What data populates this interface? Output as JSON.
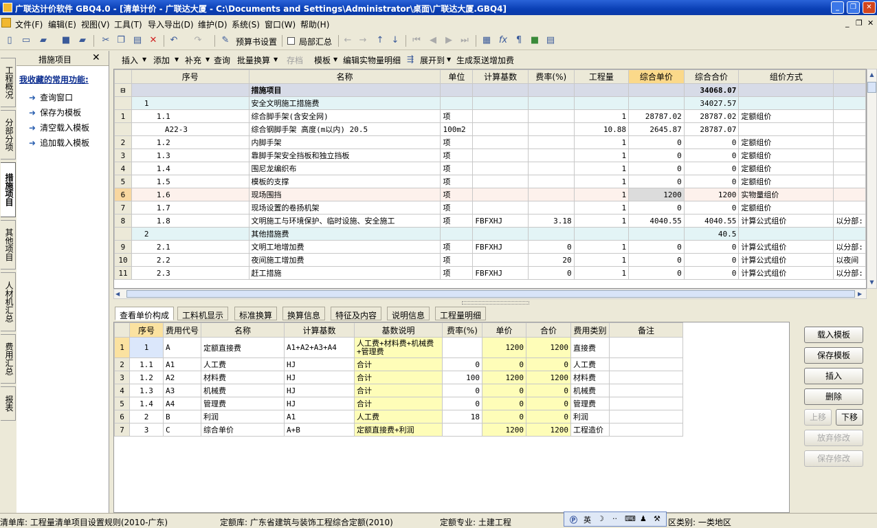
{
  "title": "广联达计价软件 GBQ4.0 - [清单计价 - 广联达大厦 - C:\\Documents and Settings\\Administrator\\桌面\\广联达大厦.GBQ4]",
  "menu": [
    "文件(F)",
    "编辑(E)",
    "视图(V)",
    "工具(T)",
    "导入导出(D)",
    "维护(D)",
    "系统(S)",
    "窗口(W)",
    "帮助(H)"
  ],
  "toolbar": {
    "budget_settings": "预算书设置",
    "partial_summary": "局部汇总"
  },
  "left_tabs": [
    "工程概况",
    "分部分项",
    "措施项目",
    "其他项目",
    "人材机汇总",
    "费用汇总",
    "报表"
  ],
  "fav_panel": {
    "header": "措施项目",
    "title": "我收藏的常用功能:",
    "items": [
      "查询窗口",
      "保存为模板",
      "清空载入模板",
      "追加载入模板"
    ]
  },
  "subtoolbar": [
    "插入",
    "添加",
    "补充",
    "查询",
    "批量换算",
    "存档",
    "模板",
    "编辑实物量明细",
    "展开到",
    "生成泵送增加费"
  ],
  "grid": {
    "headers": [
      "序号",
      "名称",
      "单位",
      "计算基数",
      "费率(%)",
      "工程量",
      "综合单价",
      "综合合价",
      "组价方式"
    ],
    "rows": [
      {
        "rn": "",
        "seq": "",
        "name": "措施项目",
        "unit": "",
        "base": "",
        "rate": "",
        "qty": "",
        "price": "",
        "total": "34068.07",
        "mode": "",
        "extra": ""
      },
      {
        "rn": "",
        "seq": "1",
        "name": "安全文明施工措施费",
        "unit": "",
        "base": "",
        "rate": "",
        "qty": "",
        "price": "",
        "total": "34027.57",
        "mode": "",
        "extra": ""
      },
      {
        "rn": "1",
        "seq": "1.1",
        "name": "综合脚手架(含安全网)",
        "unit": "项",
        "base": "",
        "rate": "",
        "qty": "1",
        "price": "28787.02",
        "total": "28787.02",
        "mode": "定额组价",
        "extra": ""
      },
      {
        "rn": "",
        "seq": "A22-3",
        "name": "综合钢脚手架 高度(m以内) 20.5",
        "unit": "100m2",
        "base": "",
        "rate": "",
        "qty": "10.88",
        "price": "2645.87",
        "total": "28787.07",
        "mode": "",
        "extra": ""
      },
      {
        "rn": "2",
        "seq": "1.2",
        "name": "内脚手架",
        "unit": "项",
        "base": "",
        "rate": "",
        "qty": "1",
        "price": "0",
        "total": "0",
        "mode": "定额组价",
        "extra": ""
      },
      {
        "rn": "3",
        "seq": "1.3",
        "name": "靠脚手架安全挡板和独立挡板",
        "unit": "项",
        "base": "",
        "rate": "",
        "qty": "1",
        "price": "0",
        "total": "0",
        "mode": "定额组价",
        "extra": ""
      },
      {
        "rn": "4",
        "seq": "1.4",
        "name": "围尼龙编织布",
        "unit": "项",
        "base": "",
        "rate": "",
        "qty": "1",
        "price": "0",
        "total": "0",
        "mode": "定额组价",
        "extra": ""
      },
      {
        "rn": "5",
        "seq": "1.5",
        "name": "模板的支撑",
        "unit": "项",
        "base": "",
        "rate": "",
        "qty": "1",
        "price": "0",
        "total": "0",
        "mode": "定额组价",
        "extra": ""
      },
      {
        "rn": "6",
        "seq": "1.6",
        "name": "现场围挡",
        "unit": "项",
        "base": "",
        "rate": "",
        "qty": "1",
        "price": "1200",
        "total": "1200",
        "mode": "实物量组价",
        "extra": ""
      },
      {
        "rn": "7",
        "seq": "1.7",
        "name": "现场设置的卷扬机架",
        "unit": "项",
        "base": "",
        "rate": "",
        "qty": "1",
        "price": "0",
        "total": "0",
        "mode": "定额组价",
        "extra": ""
      },
      {
        "rn": "8",
        "seq": "1.8",
        "name": "文明施工与环境保护、临时设施、安全施工",
        "unit": "项",
        "base": "FBFXHJ",
        "rate": "3.18",
        "qty": "1",
        "price": "4040.55",
        "total": "4040.55",
        "mode": "计算公式组价",
        "extra": "以分部:"
      },
      {
        "rn": "",
        "seq": "2",
        "name": "其他措施费",
        "unit": "",
        "base": "",
        "rate": "",
        "qty": "",
        "price": "",
        "total": "40.5",
        "mode": "",
        "extra": ""
      },
      {
        "rn": "9",
        "seq": "2.1",
        "name": "文明工地增加费",
        "unit": "项",
        "base": "FBFXHJ",
        "rate": "0",
        "qty": "1",
        "price": "0",
        "total": "0",
        "mode": "计算公式组价",
        "extra": "以分部:"
      },
      {
        "rn": "10",
        "seq": "2.2",
        "name": "夜间施工增加费",
        "unit": "项",
        "base": "",
        "rate": "20",
        "qty": "1",
        "price": "0",
        "total": "0",
        "mode": "计算公式组价",
        "extra": "以夜间"
      },
      {
        "rn": "11",
        "seq": "2.3",
        "name": "赶工措施",
        "unit": "项",
        "base": "FBFXHJ",
        "rate": "0",
        "qty": "1",
        "price": "0",
        "total": "0",
        "mode": "计算公式组价",
        "extra": "以分部:"
      }
    ]
  },
  "bottom_tabs": [
    "查看单价构成",
    "工料机显示",
    "标准换算",
    "换算信息",
    "特征及内容",
    "说明信息",
    "工程量明细"
  ],
  "detail": {
    "headers": [
      "序号",
      "费用代号",
      "名称",
      "计算基数",
      "基数说明",
      "费率(%)",
      "单价",
      "合价",
      "费用类别",
      "备注"
    ],
    "rows": [
      {
        "rn": "1",
        "seq": "1",
        "code": "A",
        "name": "定额直接费",
        "base": "A1+A2+A3+A4",
        "desc": "人工费+材料费+机械费+管理费",
        "rate": "",
        "price": "1200",
        "total": "1200",
        "cat": "直接费",
        "note": ""
      },
      {
        "rn": "2",
        "seq": "1.1",
        "code": "A1",
        "name": "人工费",
        "base": "HJ",
        "desc": "合计",
        "rate": "0",
        "price": "0",
        "total": "0",
        "cat": "人工费",
        "note": ""
      },
      {
        "rn": "3",
        "seq": "1.2",
        "code": "A2",
        "name": "材料费",
        "base": "HJ",
        "desc": "合计",
        "rate": "100",
        "price": "1200",
        "total": "1200",
        "cat": "材料费",
        "note": ""
      },
      {
        "rn": "4",
        "seq": "1.3",
        "code": "A3",
        "name": "机械费",
        "base": "HJ",
        "desc": "合计",
        "rate": "0",
        "price": "0",
        "total": "0",
        "cat": "机械费",
        "note": ""
      },
      {
        "rn": "5",
        "seq": "1.4",
        "code": "A4",
        "name": "管理费",
        "base": "HJ",
        "desc": "合计",
        "rate": "0",
        "price": "0",
        "total": "0",
        "cat": "管理费",
        "note": ""
      },
      {
        "rn": "6",
        "seq": "2",
        "code": "B",
        "name": "利润",
        "base": "A1",
        "desc": "人工费",
        "rate": "18",
        "price": "0",
        "total": "0",
        "cat": "利润",
        "note": ""
      },
      {
        "rn": "7",
        "seq": "3",
        "code": "C",
        "name": "综合单价",
        "base": "A+B",
        "desc": "定额直接费+利润",
        "rate": "",
        "price": "1200",
        "total": "1200",
        "cat": "工程造价",
        "note": ""
      }
    ]
  },
  "right_buttons": {
    "load": "载入模板",
    "save": "保存模板",
    "insert": "插入",
    "delete": "删除",
    "up": "上移",
    "down": "下移",
    "discard": "放弃修改",
    "save_changes": "保存修改"
  },
  "status": {
    "lib": "清单库: 工程量清单项目设置规则(2010-广东)",
    "quota": "定额库: 广东省建筑与装饰工程综合定额(2010)",
    "major": "定额专业: 土建工程",
    "region": "区类别: 一类地区"
  },
  "ime": {
    "label": "英"
  }
}
